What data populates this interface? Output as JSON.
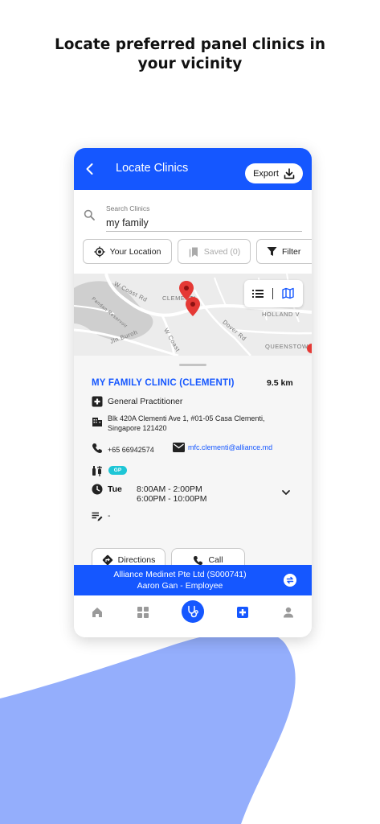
{
  "headline": {
    "line1": "Locate preferred panel clinics in",
    "line2": "your vicinity"
  },
  "colors": {
    "brand_blue": "#1557ff",
    "blob": "#94aefc",
    "gp_badge": "#1ec6d6",
    "pin_red": "#e53935"
  },
  "appbar": {
    "title": "Locate Clinics",
    "export_label": "Export",
    "back_icon": "chevron-left-icon",
    "export_icon": "download-icon"
  },
  "search": {
    "label": "Search Clinics",
    "value": "my family"
  },
  "chips": {
    "location": "Your Location",
    "saved": "Saved (0)",
    "filter": "Filter"
  },
  "map": {
    "labels": {
      "w_coast_rd_1": "W Coast Rd",
      "clementi": "CLEMENTI",
      "holland": "HOLLAND V",
      "dover": "Dover Rd",
      "w_coast_2": "W Coast",
      "jln_buroh": "Jln Buroh",
      "pandan": "Pandan Reservoir",
      "queenstown": "QUEENSTOW"
    }
  },
  "clinic": {
    "name": "MY FAMILY CLINIC (CLEMENTI)",
    "distance": "9.5 km",
    "type": "General Practitioner",
    "address_line1": "Blk 420A Clementi Ave 1, #01-05 Casa Clementi,",
    "address_line2": "Singapore 121420",
    "phone": "+65 66942574",
    "email": "mfc.clementi@alliance.md",
    "badge": "GP",
    "day": "Tue",
    "hours_1": "8:00AM - 2:00PM",
    "hours_2": "6:00PM - 10:00PM",
    "note": "-"
  },
  "actions": {
    "directions": "Directions",
    "call": "Call"
  },
  "company": {
    "line1": "Alliance Medinet Pte Ltd (S000741)",
    "line2": "Aaron Gan - Employee"
  },
  "nav": {
    "icons": [
      "home-icon",
      "grid-icon",
      "stethoscope-icon",
      "medical-cross-icon",
      "person-icon"
    ],
    "active": "stethoscope-icon"
  }
}
